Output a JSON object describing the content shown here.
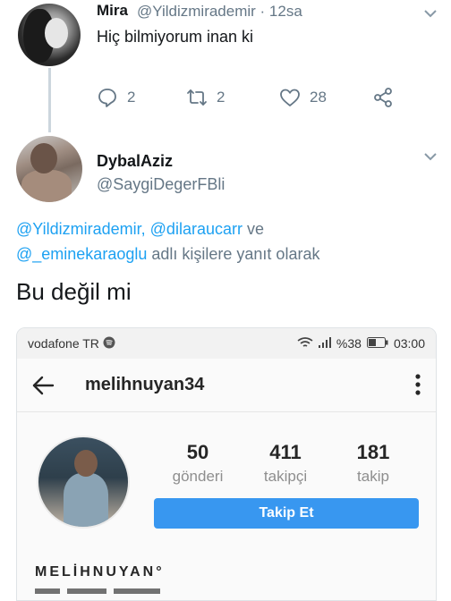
{
  "tweet1": {
    "name": "Mira",
    "handle_time": "@Yildizmirademir · 12sa",
    "text": "Hiç bilmiyorum inan ki",
    "replies": "2",
    "retweets": "2",
    "likes": "28"
  },
  "tweet2": {
    "name": "DybalAziz",
    "handle": "@SaygiDegerFBli",
    "reply_mention_1": "@Yildizmirademir,",
    "reply_mention_2": "@dilaraucarr",
    "reply_and": "ve",
    "reply_mention_3": "@_eminekaraoglu",
    "reply_suffix": "adlı kişilere yanıt olarak",
    "text": "Bu değil mi"
  },
  "screenshot": {
    "carrier": "vodafone TR",
    "battery": "%38",
    "time": "03:00",
    "username": "melihnuyan34",
    "stats": [
      {
        "value": "50",
        "label": "gönderi"
      },
      {
        "value": "411",
        "label": "takipçi"
      },
      {
        "value": "181",
        "label": "takip"
      }
    ],
    "follow_label": "Takip Et",
    "profile_name": "MELİHNUYAN°"
  },
  "colors": {
    "link": "#1da1f2",
    "muted": "#657786",
    "follow_button": "#3897f0"
  },
  "icons": [
    "reply-icon",
    "retweet-icon",
    "like-icon",
    "share-icon",
    "chevron-down-icon",
    "back-arrow-icon",
    "more-vertical-icon",
    "wifi-icon",
    "signal-icon",
    "battery-icon",
    "spotify-icon"
  ]
}
